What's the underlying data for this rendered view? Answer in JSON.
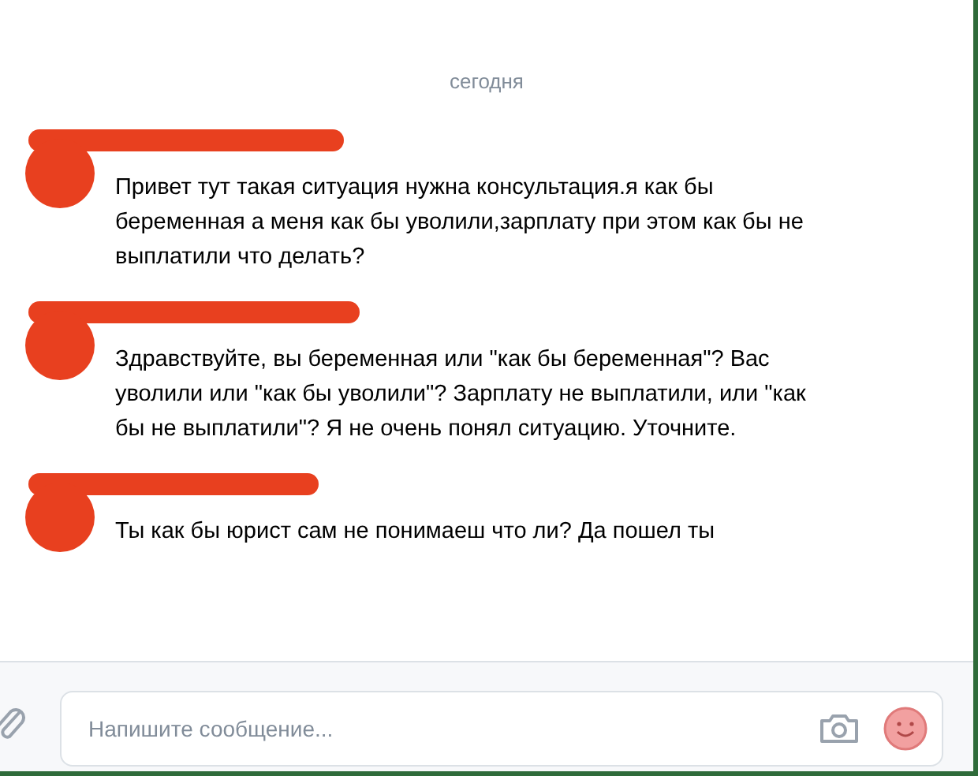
{
  "date_divider": "сегодня",
  "messages": [
    {
      "text": "Привет тут такая ситуация нужна консультация.я как бы беременная а меня как бы уволили,зарплату при этом как бы не выплатили что делать?"
    },
    {
      "text": "Здравствуйте, вы беременная или \"как бы беременная\"? Вас уволили или \"как бы уволили\"? Зарплату не выплатили, или \"как бы не выплатили\"? Я не очень понял ситуацию. Уточните."
    },
    {
      "text": "Ты как бы юрист сам не понимаеш что ли? Да пошел ты"
    }
  ],
  "composer": {
    "placeholder": "Напишите сообщение..."
  }
}
